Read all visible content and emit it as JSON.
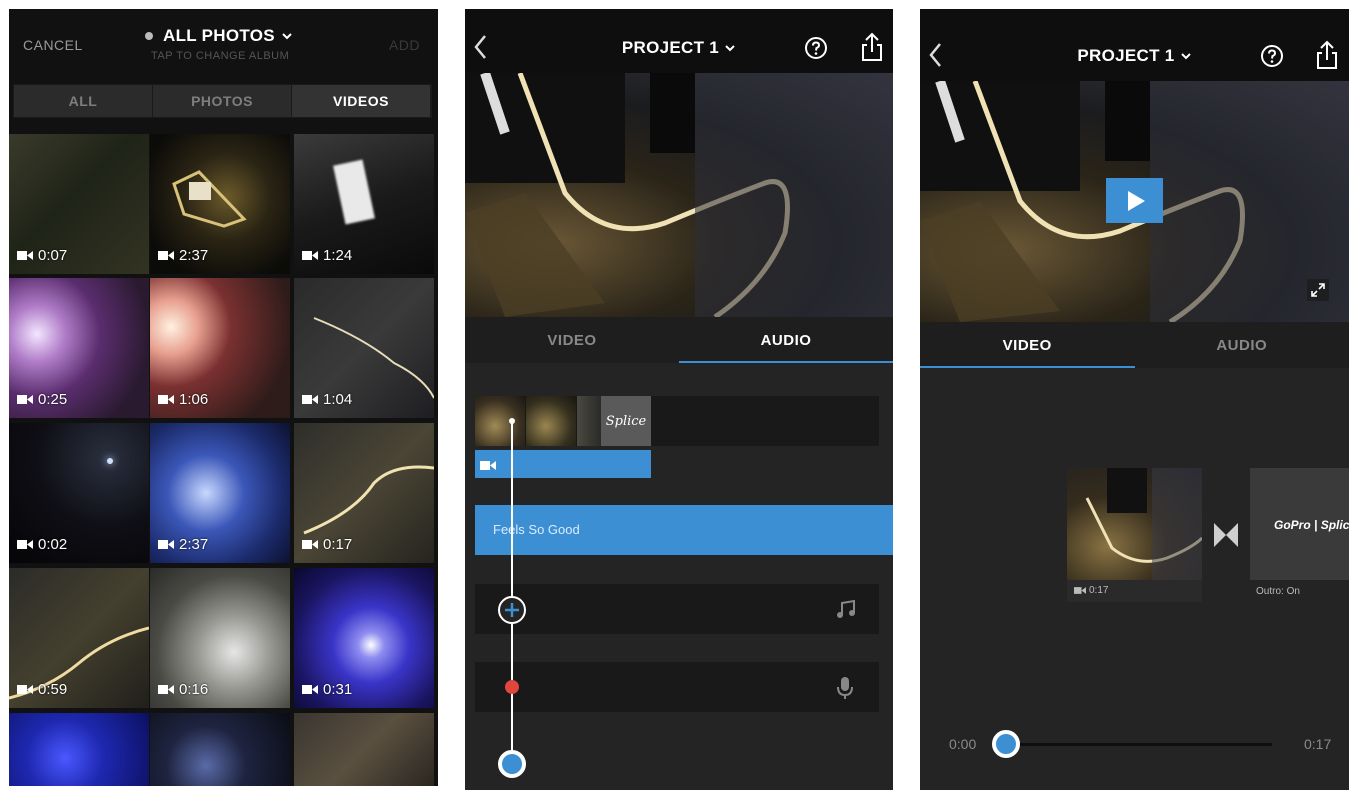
{
  "picker": {
    "cancel_label": "CANCEL",
    "album_title": "ALL PHOTOS",
    "album_subtitle": "TAP TO CHANGE ALBUM",
    "add_label": "ADD",
    "segments": [
      "ALL",
      "PHOTOS",
      "VIDEOS"
    ],
    "selected_segment": "VIDEOS",
    "durations": [
      "0:07",
      "2:37",
      "1:24",
      "0:25",
      "1:06",
      "1:04",
      "0:02",
      "2:37",
      "0:17",
      "0:59",
      "0:16",
      "0:31"
    ]
  },
  "editor_audio": {
    "title": "PROJECT 1",
    "tabs": [
      "VIDEO",
      "AUDIO"
    ],
    "active_tab": "AUDIO",
    "song_label": "Feels So Good",
    "outro_logo_text": "Splice"
  },
  "editor_video": {
    "title": "PROJECT 1",
    "tabs": [
      "VIDEO",
      "AUDIO"
    ],
    "active_tab": "VIDEO",
    "clip_duration": "0:17",
    "outro_caption": "Outro: On",
    "outro_logo_text": "GoPro | Splice",
    "time_start": "0:00",
    "time_end": "0:17"
  },
  "colors": {
    "accent_blue": "#3d8fd4",
    "record_red": "#e0463b",
    "panel_bg": "#242424"
  }
}
